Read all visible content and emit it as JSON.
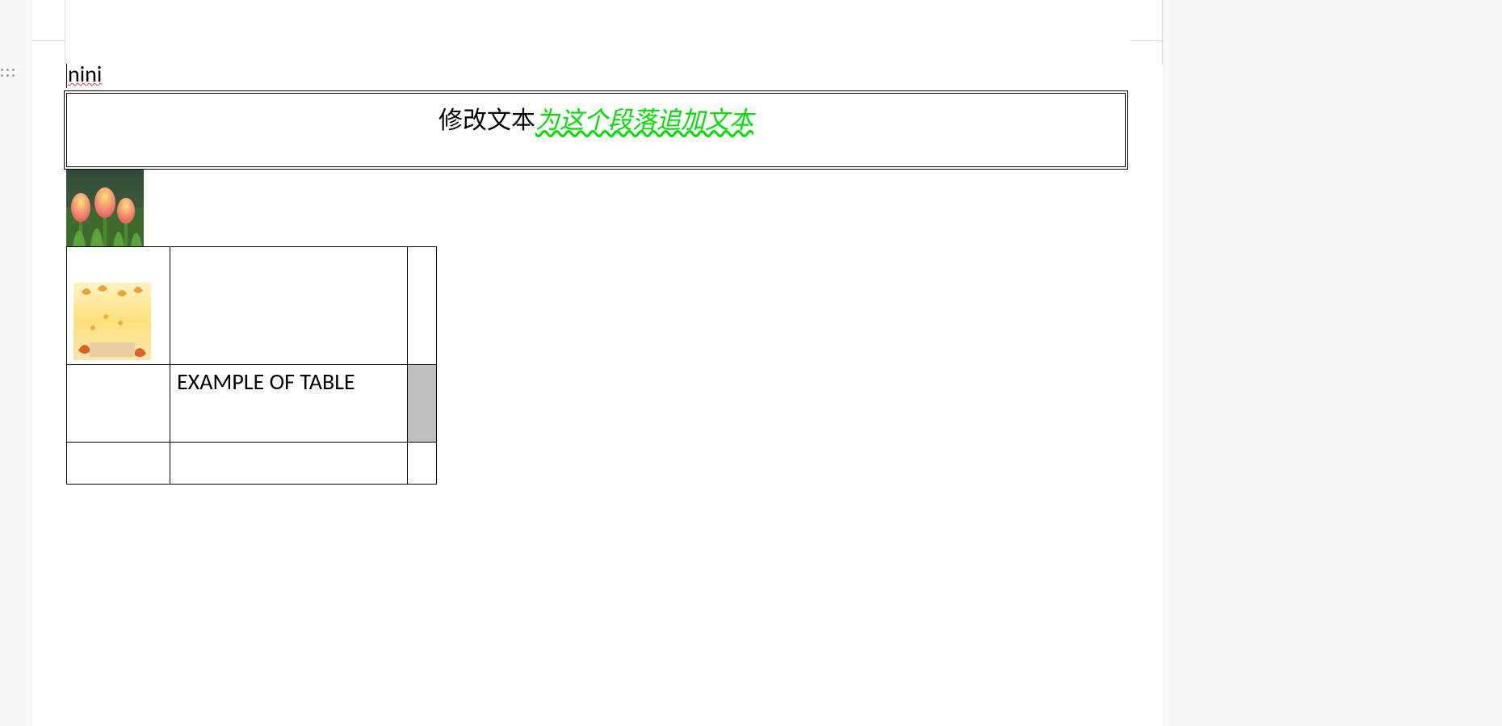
{
  "line1": "nini",
  "textbox": {
    "plain": "修改文本",
    "appended": "为这个段落追加文本"
  },
  "images": {
    "tulips_alt": "tulips-photo",
    "leaves_alt": "autumn-leaves-photo"
  },
  "table": {
    "rows": [
      {
        "cells": [
          "",
          "",
          ""
        ]
      },
      {
        "cells": [
          "",
          "EXAMPLE OF TABLE",
          ""
        ]
      },
      {
        "cells": [
          "",
          "",
          ""
        ]
      }
    ]
  }
}
